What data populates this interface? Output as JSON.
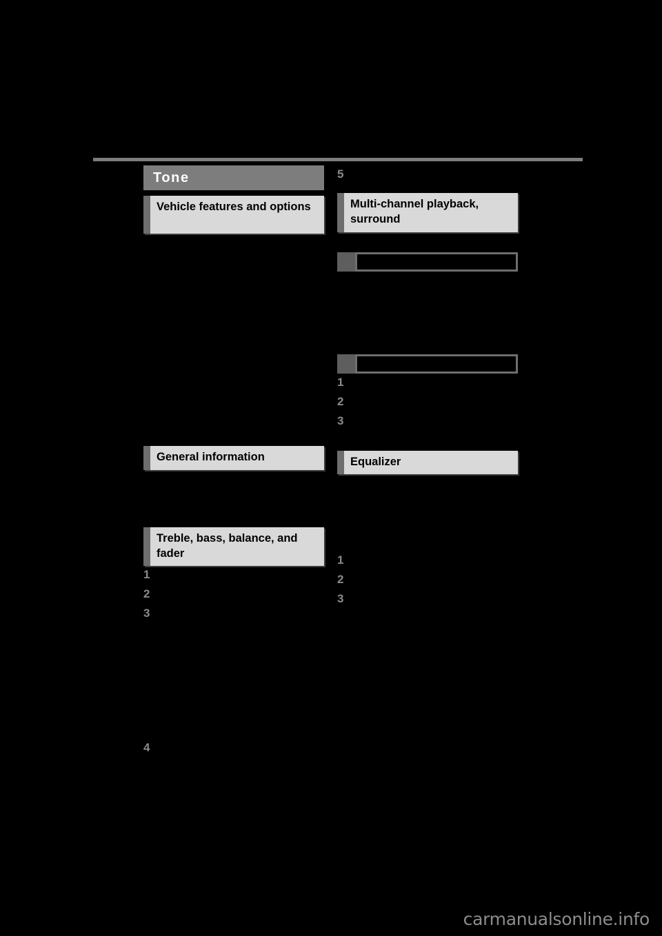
{
  "page": {
    "background_color": "#000000",
    "chapter_bar_color": "#7d7d7d",
    "section_body_color": "#d9d9d9",
    "section_tab_color": "#6e6e6e",
    "marker_color": "#8a8a8a",
    "rule_color": "#7d7d7d"
  },
  "chapter": {
    "title": "Tone"
  },
  "left_column": {
    "sections": [
      {
        "title": "Vehicle features and options"
      },
      {
        "title": "General information"
      },
      {
        "title": "Treble, bass, balance, and fader"
      }
    ],
    "steps": [
      "1",
      "2",
      "3"
    ],
    "trailing_marker": "4"
  },
  "right_column": {
    "top_marker": "5",
    "sections": [
      {
        "title": "Multi-channel playback, surround"
      },
      {
        "title": "",
        "style": "outline"
      },
      {
        "title": "",
        "style": "outline"
      },
      {
        "title": "Equalizer"
      }
    ],
    "steps_upper": [
      "1",
      "2",
      "3"
    ],
    "steps_lower": [
      "1",
      "2",
      "3"
    ]
  },
  "footer": {
    "watermark": "carmanualsonline.info"
  }
}
